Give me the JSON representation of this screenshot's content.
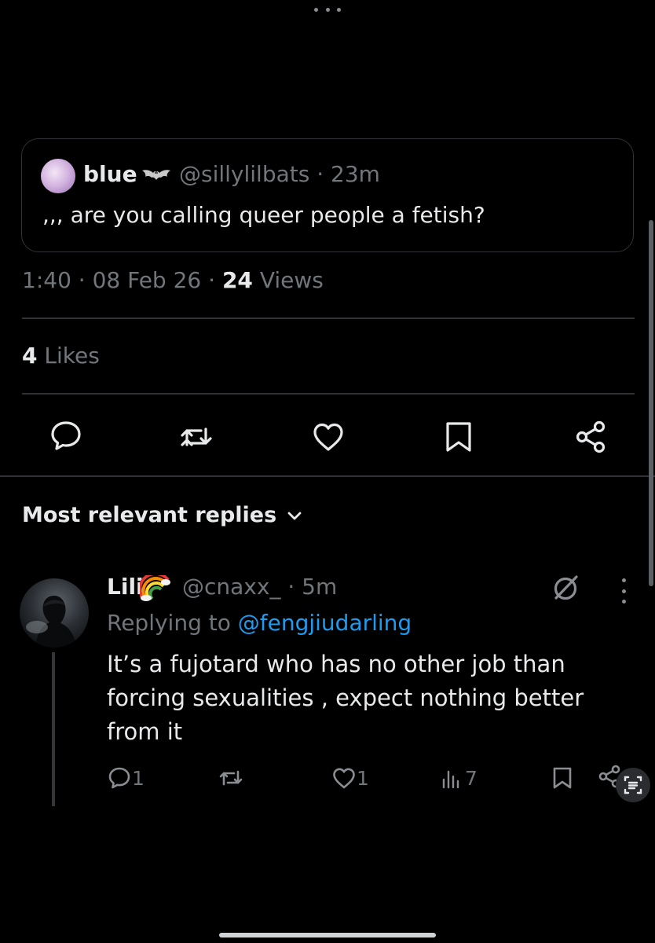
{
  "quoted_post": {
    "avatar_icon": "profile-avatar",
    "name": "blue",
    "name_emoji": "bat-icon",
    "handle": "@sillylilbats",
    "time": "23m",
    "text": ",,, are you calling queer people a fetish?"
  },
  "post_meta": {
    "time": "1:40",
    "date": "08 Feb 26",
    "views_count": "24",
    "views_label": "Views"
  },
  "engagement": {
    "likes_count": "4",
    "likes_label": "Likes"
  },
  "actions": {
    "icons": [
      "comment-icon",
      "repost-icon",
      "like-icon",
      "bookmark-icon",
      "share-icon"
    ]
  },
  "replies_section": {
    "sort_label": "Most relevant replies"
  },
  "reply": {
    "name": "Lili",
    "name_emoji": "rainbow-icon",
    "handle": "@cnaxx_",
    "time": "5m",
    "replying_prefix": "Replying to",
    "replying_mention": "@fengjiudarling",
    "text": "It’s a fujotard who has no other job than forcing sexualities , expect nothing better from it",
    "reply_count": "1",
    "like_count": "1",
    "view_count": "7"
  },
  "colors": {
    "background": "#000000",
    "primary_text": "#e7e9ea",
    "secondary_text": "#71767b",
    "accent_link": "#1d9bf0",
    "divider": "#2f3336"
  }
}
